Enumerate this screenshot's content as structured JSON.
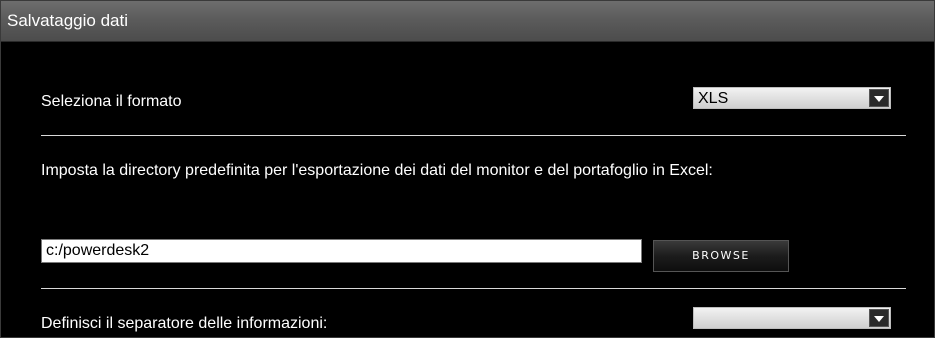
{
  "panel": {
    "title": "Salvataggio dati"
  },
  "format": {
    "label": "Seleziona il formato",
    "selected": "XLS"
  },
  "export_dir": {
    "description": "Imposta la directory predefinita per l'esportazione dei dati del monitor e del portafoglio in Excel:",
    "value": "c:/powerdesk2",
    "browse_label": "BROWSE"
  },
  "separator": {
    "label": "Definisci il separatore delle informazioni:",
    "selected": ""
  },
  "colors": {
    "background": "#000000",
    "header": "#5a5a5a",
    "text": "#ffffff"
  }
}
